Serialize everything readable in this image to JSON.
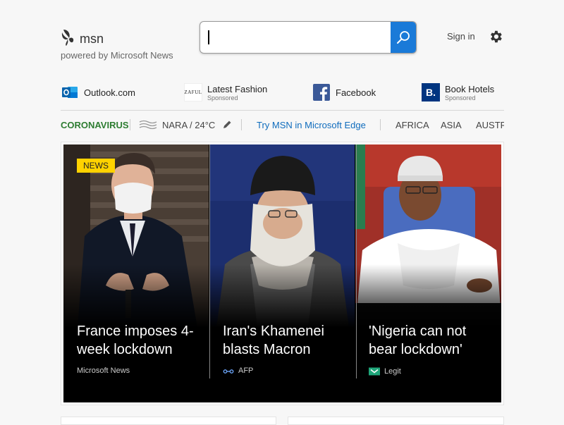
{
  "header": {
    "logo_text": "msn",
    "powered_by": "powered by Microsoft News",
    "search": {
      "value": "",
      "placeholder": ""
    },
    "signin_label": "Sign in"
  },
  "quick_links": [
    {
      "label": "Outlook.com",
      "sub": "",
      "icon": "outlook-icon"
    },
    {
      "label": "Latest Fashion",
      "sub": "Sponsored",
      "icon": "zaful-logo",
      "logo_text": "ZAFUL"
    },
    {
      "label": "Facebook",
      "sub": "",
      "icon": "facebook-icon"
    },
    {
      "label": "Book Hotels",
      "sub": "Sponsored",
      "icon": "booking-icon",
      "logo_text": "B."
    }
  ],
  "ribbon": {
    "coronavirus": "CORONAVIRUS",
    "weather": "NARA / 24°C",
    "edge_promo": "Try MSN in Microsoft Edge",
    "regions": [
      "AFRICA",
      "ASIA",
      "AUSTRA"
    ]
  },
  "hero": {
    "badge": "NEWS",
    "panels": [
      {
        "title": "France imposes 4-week lockdown",
        "source": "Microsoft News"
      },
      {
        "title": "Iran's Khamenei blasts Macron",
        "source": "AFP"
      },
      {
        "title": "'Nigeria can not bear lockdown'",
        "source": "Legit"
      }
    ]
  },
  "colors": {
    "accent_blue": "#1a7ad8",
    "coronavirus_green": "#2e7d32",
    "edge_link": "#0f6cbd",
    "badge_yellow": "#ffd200"
  }
}
